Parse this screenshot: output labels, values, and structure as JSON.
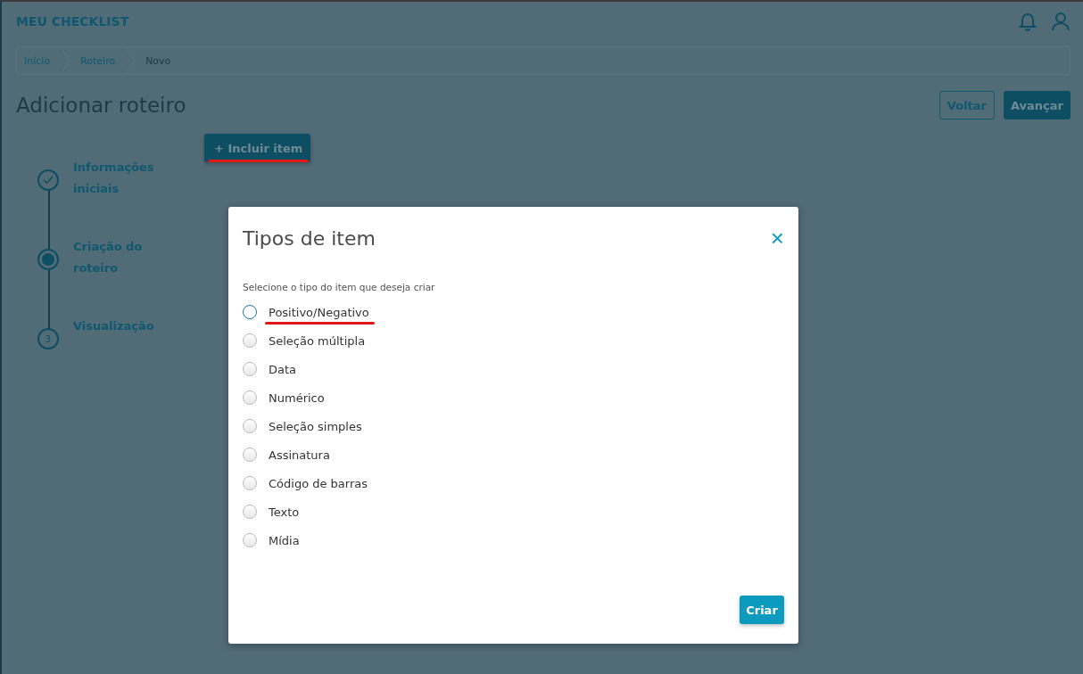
{
  "header": {
    "title": "MEU CHECKLIST"
  },
  "breadcrumb": [
    {
      "label": "Início"
    },
    {
      "label": "Roteiro"
    },
    {
      "label": "Novo"
    }
  ],
  "page": {
    "title": "Adicionar roteiro",
    "buttons": [
      {
        "label": "Voltar",
        "kind": "secondary"
      },
      {
        "label": "Avançar",
        "kind": "primary"
      }
    ]
  },
  "add_button": {
    "label": "+ Incluir item"
  },
  "steps": [
    {
      "label": "Informações iniciais",
      "kind": "done"
    },
    {
      "label": "Criação do roteiro",
      "kind": "current"
    },
    {
      "label": "Visualização",
      "kind": "pending",
      "number": "3"
    }
  ],
  "dialog": {
    "title": "Tipos de item",
    "close": "×",
    "prompt": "Selecione o tipo do item que deseja criar",
    "options": [
      {
        "label": "Positivo/Negativo",
        "selected": false,
        "focused": true
      },
      {
        "label": "Seleção múltipla",
        "selected": false,
        "focused": false
      },
      {
        "label": "Data",
        "selected": false,
        "focused": false
      },
      {
        "label": "Numérico",
        "selected": false,
        "focused": false
      },
      {
        "label": "Seleção simples",
        "selected": false,
        "focused": false
      },
      {
        "label": "Assinatura",
        "selected": false,
        "focused": false
      },
      {
        "label": "Código de barras",
        "selected": false,
        "focused": false
      },
      {
        "label": "Texto",
        "selected": false,
        "focused": false
      },
      {
        "label": "Mídia",
        "selected": false,
        "focused": false
      }
    ],
    "button": "Criar"
  }
}
